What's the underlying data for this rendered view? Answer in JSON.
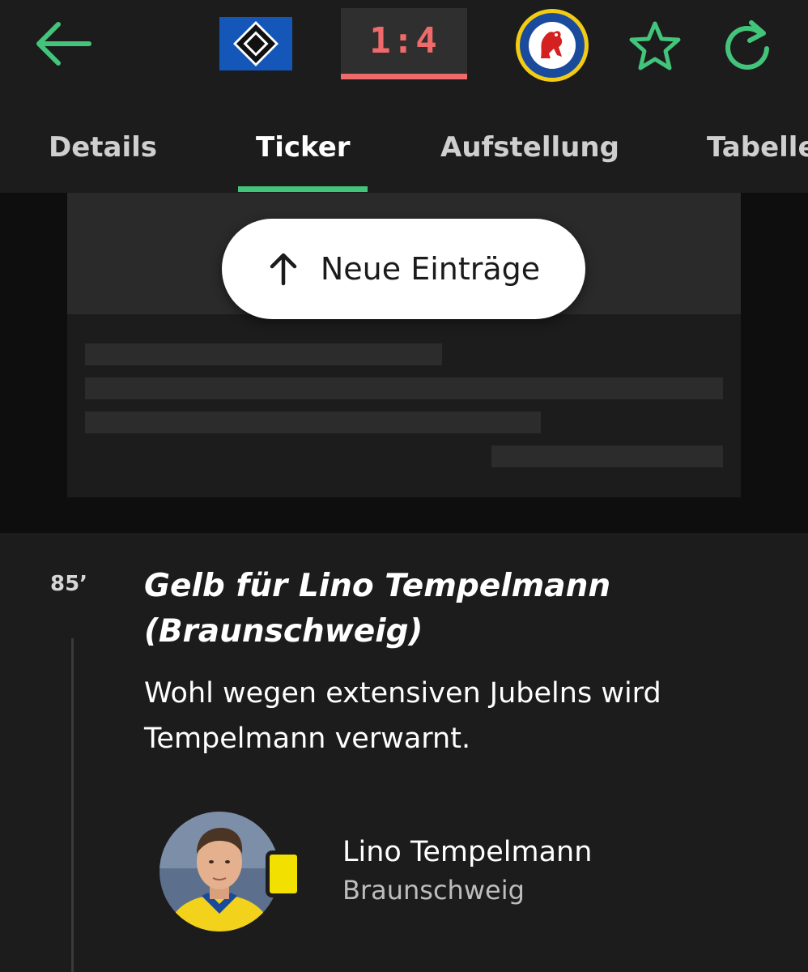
{
  "header": {
    "back_icon": "arrow-left-icon",
    "home_team_crest": "hsv-crest",
    "score": "1:4",
    "away_team_crest": "braunschweig-crest",
    "away_crest_text": "BRAUNSCHWEIGER TURN- U. SPORTVEREIN EINTRACHT E.V. 1895",
    "favorite_icon": "star-outline-icon",
    "refresh_icon": "refresh-icon",
    "accent_color": "#43c47b",
    "score_color": "#ef6a6a"
  },
  "tabs": [
    {
      "label": "Details",
      "active": false
    },
    {
      "label": "Ticker",
      "active": true
    },
    {
      "label": "Aufstellung",
      "active": false
    },
    {
      "label": "Tabelle",
      "active": false
    }
  ],
  "new_entries": {
    "icon": "arrow-up-icon",
    "label": "Neue Einträge"
  },
  "entry": {
    "minute": "85’",
    "title": "Gelb für Lino Tempelmann (Braunschweig)",
    "body": "Wohl wegen extensiven Jubelns wird Tempelmann verwarnt.",
    "player": {
      "name": "Lino Tempelmann",
      "team": "Braunschweig",
      "card": "yellow-card",
      "card_color": "#f2e100"
    }
  }
}
